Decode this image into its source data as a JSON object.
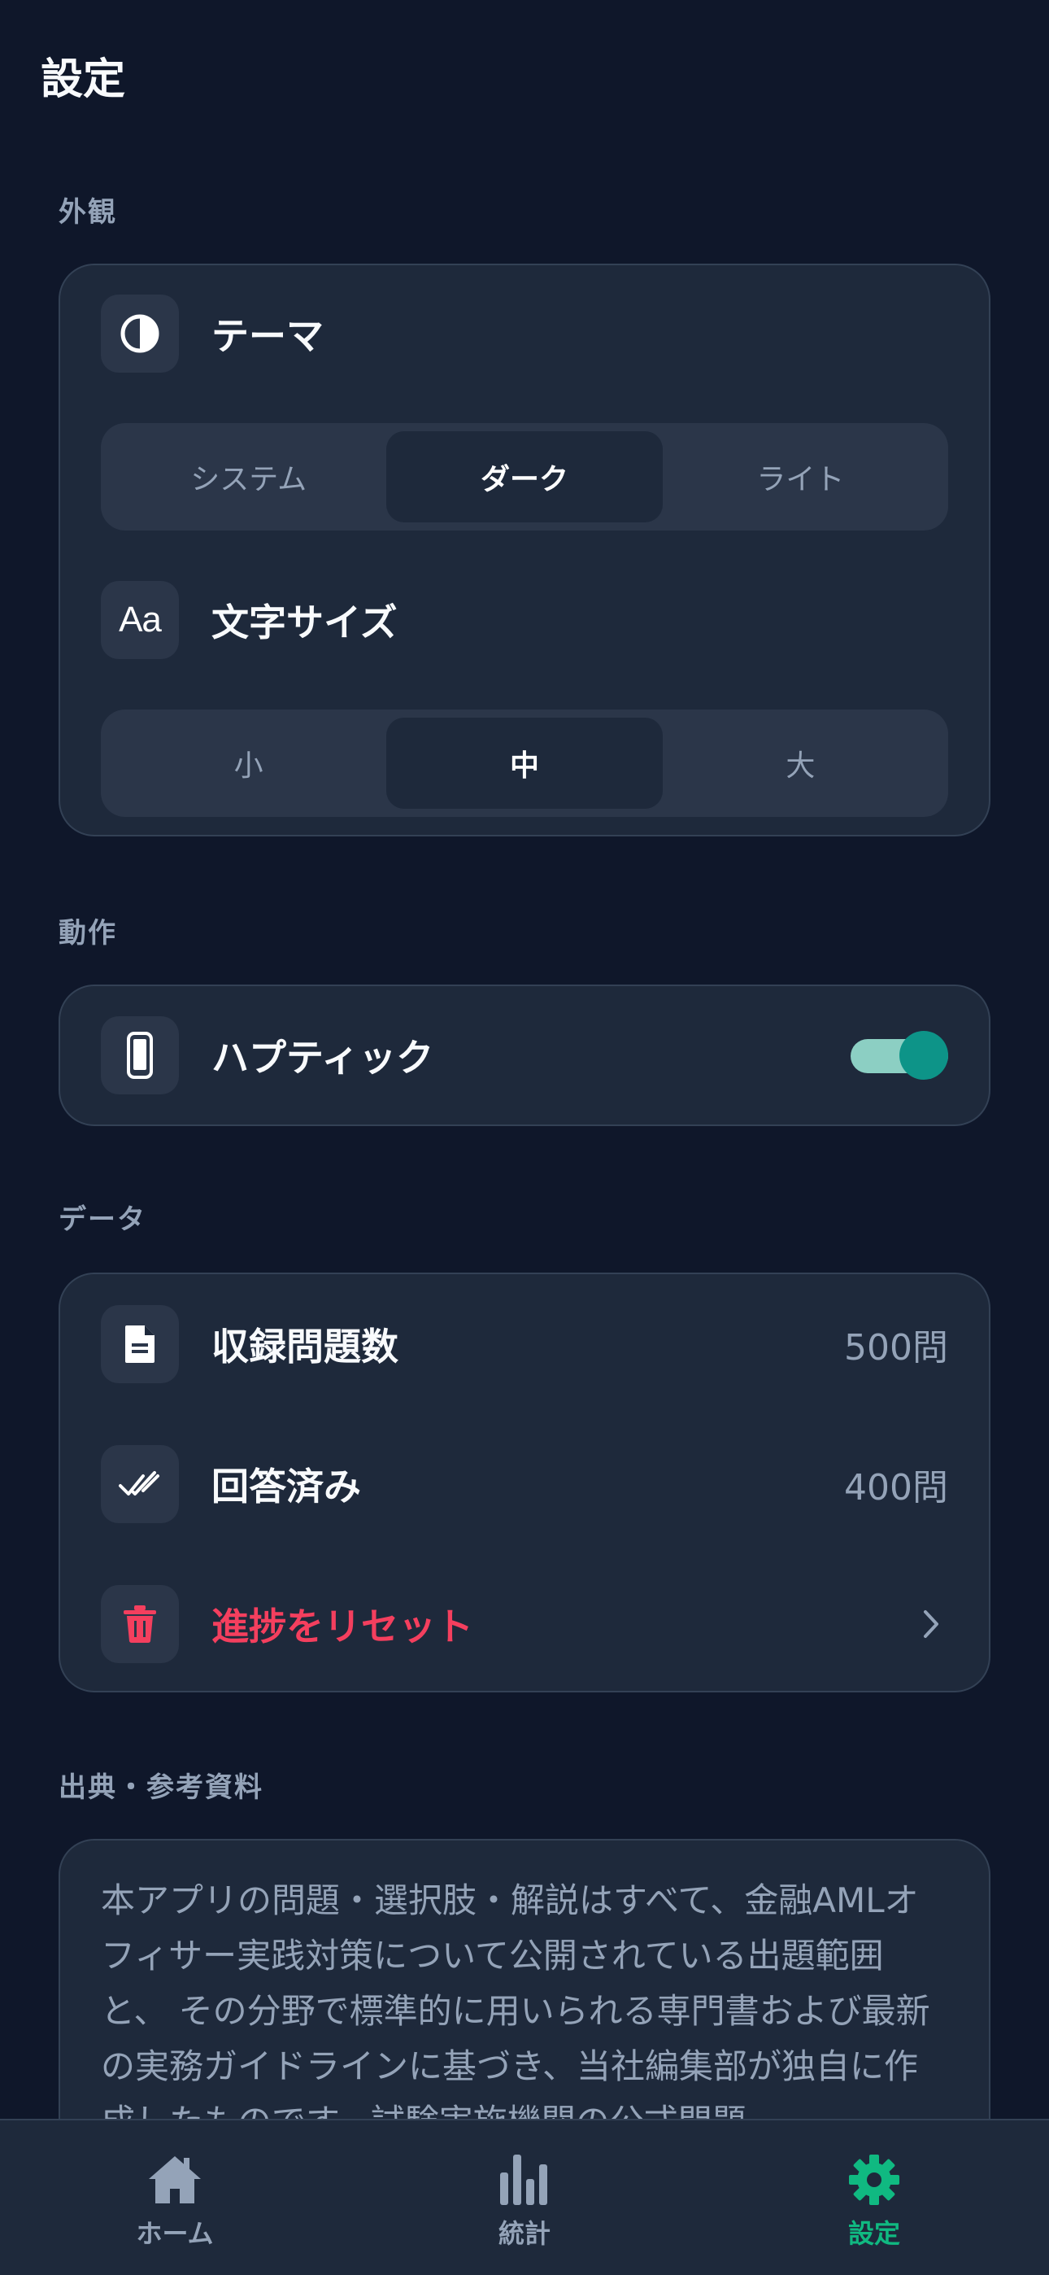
{
  "header": {
    "title": "設定"
  },
  "appearance": {
    "section_label": "外観",
    "theme": {
      "label": "テーマ",
      "icon": "contrast-icon",
      "options": [
        "システム",
        "ダーク",
        "ライト"
      ],
      "selected": "ダーク"
    },
    "font_size": {
      "label": "文字サイズ",
      "icon": "text-size-icon",
      "icon_glyph": "Aa",
      "options": [
        "小",
        "中",
        "大"
      ],
      "selected": "中"
    }
  },
  "behavior": {
    "section_label": "動作",
    "haptic": {
      "label": "ハプティック",
      "icon": "phone-icon",
      "enabled": true
    }
  },
  "data": {
    "section_label": "データ",
    "total_questions": {
      "label": "収録問題数",
      "icon": "document-icon",
      "value": "500問"
    },
    "answered": {
      "label": "回答済み",
      "icon": "double-check-icon",
      "value": "400問"
    },
    "reset": {
      "label": "進捗をリセット",
      "icon": "trash-icon"
    }
  },
  "sources": {
    "section_label": "出典・参考資料",
    "text": "本アプリの問題・選択肢・解説はすべて、金融AMLオフィサー実践対策について公開されている出題範囲と、 その分野で標準的に用いられる専門書および最新の実務ガイドラインに基づき、当社編集部が独自に作成したものです。試験実施機関の公式問題"
  },
  "nav": {
    "items": [
      {
        "label": "ホーム",
        "icon": "home-icon"
      },
      {
        "label": "統計",
        "icon": "chart-icon"
      },
      {
        "label": "設定",
        "icon": "gear-icon"
      }
    ],
    "active": "設定"
  },
  "colors": {
    "background": "#0f172a",
    "card": "#1e293b",
    "accent": "#10b981",
    "toggle": "#0d9488",
    "danger": "#f43f5e",
    "muted_text": "#94a3b8"
  }
}
